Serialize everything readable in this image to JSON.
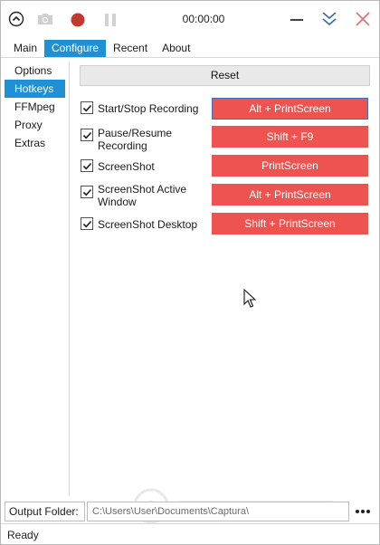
{
  "titlebar": {
    "timer": "00:00:00",
    "icons": [
      "capture-menu-icon",
      "camera-icon",
      "record-icon",
      "pause-icon",
      "minimize-icon",
      "collapse-icon",
      "close-icon"
    ],
    "colors": {
      "record": "#c0392b",
      "close": "#e57373",
      "accent": "#1e90d6"
    }
  },
  "main_tabs": [
    {
      "label": "Main"
    },
    {
      "label": "Configure"
    },
    {
      "label": "Recent"
    },
    {
      "label": "About"
    }
  ],
  "active_main_tab": "Configure",
  "sidebar": {
    "items": [
      {
        "label": "Options"
      },
      {
        "label": "Hotkeys"
      },
      {
        "label": "FFMpeg"
      },
      {
        "label": "Proxy"
      },
      {
        "label": "Extras"
      }
    ],
    "active": "Hotkeys"
  },
  "hotkeys": {
    "reset_label": "Reset",
    "rows": [
      {
        "label": "Start/Stop Recording",
        "key": "Alt + PrintScreen",
        "checked": true
      },
      {
        "label": "Pause/Resume Recording",
        "key": "Shift + F9",
        "checked": true
      },
      {
        "label": "ScreenShot",
        "key": "PrintScreen",
        "checked": true
      },
      {
        "label": "ScreenShot Active Window",
        "key": "Alt + PrintScreen",
        "checked": true
      },
      {
        "label": "ScreenShot Desktop",
        "key": "Shift + PrintScreen",
        "checked": true
      }
    ],
    "button_color": "#ef5350"
  },
  "output": {
    "label": "Output Folder:",
    "path": "C:\\Users\\User\\Documents\\Captura\\",
    "more_icon": "more-dots-icon"
  },
  "status": {
    "text": "Ready"
  }
}
